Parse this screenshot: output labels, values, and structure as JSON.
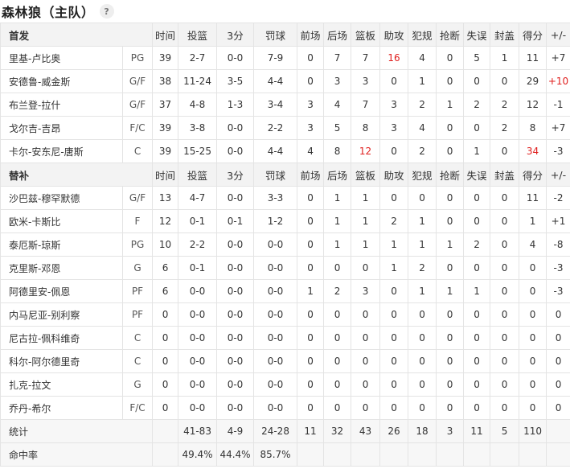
{
  "header": {
    "title": "森林狼（主队）",
    "help_icon": "?"
  },
  "colors": {
    "highlight": "#e0201f"
  },
  "columns": [
    "时间",
    "投篮",
    "3分",
    "罚球",
    "前场",
    "后场",
    "篮板",
    "助攻",
    "犯规",
    "抢断",
    "失误",
    "封盖",
    "得分",
    "+/-"
  ],
  "starters": {
    "label": "首发",
    "rows": [
      {
        "name": "里基-卢比奥",
        "pos": "PG",
        "stats": [
          "39",
          "2-7",
          "0-0",
          "7-9",
          "0",
          "7",
          "7",
          "16",
          "4",
          "0",
          "5",
          "1",
          "11",
          "+7"
        ],
        "hl": [
          7
        ]
      },
      {
        "name": "安德鲁-威金斯",
        "pos": "G/F",
        "stats": [
          "38",
          "11-24",
          "3-5",
          "4-4",
          "0",
          "3",
          "3",
          "0",
          "1",
          "0",
          "0",
          "0",
          "29",
          "+10"
        ],
        "hl": [
          13
        ]
      },
      {
        "name": "布兰登-拉什",
        "pos": "G/F",
        "stats": [
          "37",
          "4-8",
          "1-3",
          "3-4",
          "3",
          "4",
          "7",
          "3",
          "2",
          "1",
          "2",
          "2",
          "12",
          "-1"
        ],
        "hl": []
      },
      {
        "name": "戈尔吉-吉昂",
        "pos": "F/C",
        "stats": [
          "39",
          "3-8",
          "0-0",
          "2-2",
          "3",
          "5",
          "8",
          "3",
          "4",
          "0",
          "0",
          "2",
          "8",
          "+7"
        ],
        "hl": []
      },
      {
        "name": "卡尔-安东尼-唐斯",
        "pos": "C",
        "stats": [
          "39",
          "15-25",
          "0-0",
          "4-4",
          "4",
          "8",
          "12",
          "0",
          "2",
          "0",
          "1",
          "0",
          "34",
          "-3"
        ],
        "hl": [
          6,
          12
        ]
      }
    ]
  },
  "bench": {
    "label": "替补",
    "rows": [
      {
        "name": "沙巴兹-穆罕默德",
        "pos": "G/F",
        "stats": [
          "13",
          "4-7",
          "0-0",
          "3-3",
          "0",
          "1",
          "1",
          "0",
          "0",
          "0",
          "0",
          "0",
          "11",
          "-2"
        ],
        "hl": []
      },
      {
        "name": "欧米-卡斯比",
        "pos": "F",
        "stats": [
          "12",
          "0-1",
          "0-1",
          "1-2",
          "0",
          "1",
          "1",
          "2",
          "1",
          "0",
          "0",
          "0",
          "1",
          "+1"
        ],
        "hl": []
      },
      {
        "name": "泰厄斯-琼斯",
        "pos": "PG",
        "stats": [
          "10",
          "2-2",
          "0-0",
          "0-0",
          "0",
          "1",
          "1",
          "1",
          "1",
          "1",
          "2",
          "0",
          "4",
          "-8"
        ],
        "hl": []
      },
      {
        "name": "克里斯-邓恩",
        "pos": "G",
        "stats": [
          "6",
          "0-1",
          "0-0",
          "0-0",
          "0",
          "0",
          "0",
          "1",
          "2",
          "0",
          "0",
          "0",
          "0",
          "-3"
        ],
        "hl": []
      },
      {
        "name": "阿德里安-佩恩",
        "pos": "PF",
        "stats": [
          "6",
          "0-0",
          "0-0",
          "0-0",
          "1",
          "2",
          "3",
          "0",
          "1",
          "1",
          "1",
          "0",
          "0",
          "-3"
        ],
        "hl": []
      },
      {
        "name": "内马尼亚-别利察",
        "pos": "PF",
        "stats": [
          "0",
          "0-0",
          "0-0",
          "0-0",
          "0",
          "0",
          "0",
          "0",
          "0",
          "0",
          "0",
          "0",
          "0",
          "0"
        ],
        "hl": []
      },
      {
        "name": "尼古拉-佩科维奇",
        "pos": "C",
        "stats": [
          "0",
          "0-0",
          "0-0",
          "0-0",
          "0",
          "0",
          "0",
          "0",
          "0",
          "0",
          "0",
          "0",
          "0",
          "0"
        ],
        "hl": []
      },
      {
        "name": "科尔-阿尔德里奇",
        "pos": "C",
        "stats": [
          "0",
          "0-0",
          "0-0",
          "0-0",
          "0",
          "0",
          "0",
          "0",
          "0",
          "0",
          "0",
          "0",
          "0",
          "0"
        ],
        "hl": []
      },
      {
        "name": "扎克-拉文",
        "pos": "G",
        "stats": [
          "0",
          "0-0",
          "0-0",
          "0-0",
          "0",
          "0",
          "0",
          "0",
          "0",
          "0",
          "0",
          "0",
          "0",
          "0"
        ],
        "hl": []
      },
      {
        "name": "乔丹-希尔",
        "pos": "F/C",
        "stats": [
          "0",
          "0-0",
          "0-0",
          "0-0",
          "0",
          "0",
          "0",
          "0",
          "0",
          "0",
          "0",
          "0",
          "0",
          "0"
        ],
        "hl": []
      }
    ]
  },
  "totals": {
    "label": "统计",
    "stats": [
      "",
      "41-83",
      "4-9",
      "24-28",
      "11",
      "32",
      "43",
      "26",
      "18",
      "3",
      "11",
      "5",
      "110",
      ""
    ]
  },
  "percentages": {
    "label": "命中率",
    "stats": [
      "",
      "49.4%",
      "44.4%",
      "85.7%",
      "",
      "",
      "",
      "",
      "",
      "",
      "",
      "",
      "",
      ""
    ]
  }
}
